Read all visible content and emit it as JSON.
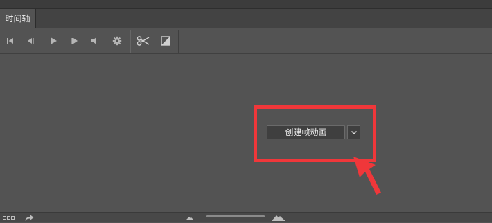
{
  "panel": {
    "tab_label": "时间轴"
  },
  "toolbar": {
    "buttons": [
      {
        "icon": "first-frame-icon"
      },
      {
        "icon": "previous-frame-icon"
      },
      {
        "icon": "play-icon"
      },
      {
        "icon": "next-frame-icon"
      },
      {
        "icon": "audio-icon"
      },
      {
        "icon": "settings-gear-icon"
      },
      {
        "icon": "split-scissors-icon"
      },
      {
        "icon": "transition-icon"
      }
    ]
  },
  "main": {
    "create_button_label": "创建帧动画",
    "dropdown_icon": "chevron-down-icon"
  },
  "annotation": {
    "highlight_color": "#f0373a"
  },
  "bottom": {
    "icons": [
      "frames-icon",
      "convert-arrow-icon",
      "zoom-out-mountain-icon",
      "zoom-in-mountain-icon"
    ]
  }
}
